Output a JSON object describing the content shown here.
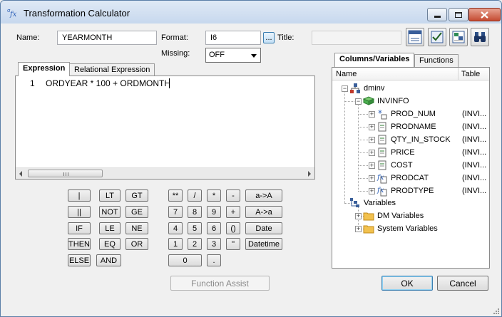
{
  "window": {
    "title": "Transformation Calculator"
  },
  "form": {
    "name_label": "Name:",
    "name_value": "YEARMONTH",
    "format_label": "Format:",
    "format_value": "I6",
    "format_button": "...",
    "title_label": "Title:",
    "title_value": "",
    "missing_label": "Missing:",
    "missing_value": "OFF"
  },
  "toolbar": {
    "icons": [
      "sql-icon",
      "check-expression-icon",
      "variable-properties-icon",
      "binoculars-icon"
    ],
    "sql_text": "SQL"
  },
  "editor": {
    "tabs": [
      "Expression",
      "Relational Expression"
    ],
    "active_tab": "Expression",
    "line_number": "1",
    "line_text": "ORDYEAR * 100 + ORDMONTH"
  },
  "keypad": {
    "row1": [
      "|",
      "LT",
      "GT",
      "**",
      "/",
      "*",
      "-",
      "a->A"
    ],
    "row2": [
      "||",
      "NOT",
      "GE",
      "7",
      "8",
      "9",
      "+",
      "A->a"
    ],
    "row3": [
      "IF",
      "LE",
      "NE",
      "4",
      "5",
      "6",
      "()",
      "Date"
    ],
    "row4": [
      "THEN",
      "EQ",
      "OR",
      "1",
      "2",
      "3",
      "''",
      "Datetime"
    ],
    "row5": [
      "ELSE",
      "AND",
      "0",
      "."
    ]
  },
  "function_assist": "Function Assist",
  "right_panel": {
    "tabs": [
      "Columns/Variables",
      "Functions"
    ],
    "active_tab": "Columns/Variables",
    "columns": [
      "Name",
      "Table"
    ],
    "tree": {
      "root": "dminv",
      "table": "INVINFO",
      "fields": [
        {
          "name": "PROD_NUM",
          "table": "(INVI...",
          "icon": "key-field-icon"
        },
        {
          "name": "PRODNAME",
          "table": "(INVI...",
          "icon": "field-icon"
        },
        {
          "name": "QTY_IN_STOCK",
          "table": "(INVI...",
          "icon": "field-icon"
        },
        {
          "name": "PRICE",
          "table": "(INVI...",
          "icon": "field-icon"
        },
        {
          "name": "COST",
          "table": "(INVI...",
          "icon": "field-icon"
        },
        {
          "name": "PRODCAT",
          "table": "(INVI...",
          "icon": "computed-field-icon"
        },
        {
          "name": "PRODTYPE",
          "table": "(INVI...",
          "icon": "computed-field-icon"
        }
      ],
      "variables": "Variables",
      "variable_groups": [
        "DM Variables",
        "System Variables"
      ]
    }
  },
  "buttons": {
    "ok": "OK",
    "cancel": "Cancel"
  }
}
